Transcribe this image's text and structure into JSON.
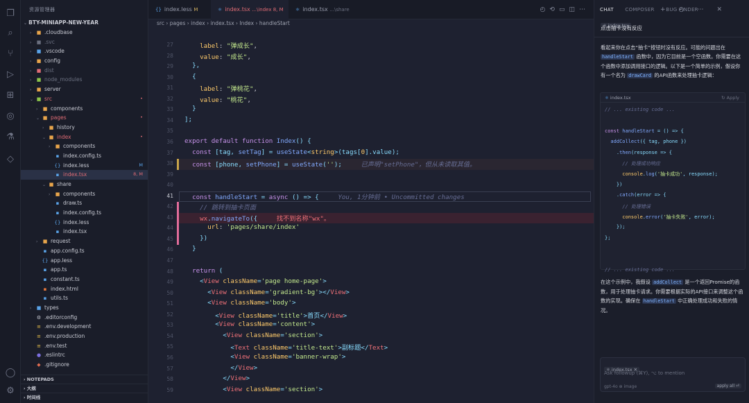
{
  "explorer": {
    "header": "资源管理器",
    "project": "BTY-MINIAPP-NEW-YEAR",
    "items": [
      {
        "name": ".cloudbase",
        "depth": 1,
        "kind": "folder",
        "open": false,
        "color": "#e8a54b"
      },
      {
        "name": ".svc",
        "depth": 1,
        "kind": "folder",
        "open": false,
        "color": "#6b7080",
        "dim": true
      },
      {
        "name": ".vscode",
        "depth": 1,
        "kind": "folder",
        "open": false,
        "color": "#5aa3e8"
      },
      {
        "name": "config",
        "depth": 1,
        "kind": "folder",
        "open": false,
        "color": "#e8a54b"
      },
      {
        "name": "dist",
        "depth": 1,
        "kind": "folder",
        "open": false,
        "color": "#e06c75",
        "dim": true
      },
      {
        "name": "node_modules",
        "depth": 1,
        "kind": "folder",
        "open": false,
        "color": "#8bc34a",
        "dim": true
      },
      {
        "name": "server",
        "depth": 1,
        "kind": "folder",
        "open": false,
        "color": "#e8a54b"
      },
      {
        "name": "src",
        "depth": 1,
        "kind": "folder",
        "open": true,
        "color": "#8bc34a",
        "text": "#e06c75",
        "dot": true
      },
      {
        "name": "components",
        "depth": 2,
        "kind": "folder",
        "open": false,
        "color": "#e8a54b"
      },
      {
        "name": "pages",
        "depth": 2,
        "kind": "folder",
        "open": true,
        "color": "#e8a54b",
        "text": "#e06c75",
        "dot": true
      },
      {
        "name": "history",
        "depth": 3,
        "kind": "folder",
        "open": false,
        "color": "#e8a54b"
      },
      {
        "name": "index",
        "depth": 3,
        "kind": "folder",
        "open": true,
        "color": "#e8a54b",
        "text": "#e06c75",
        "dot": true
      },
      {
        "name": "components",
        "depth": 4,
        "kind": "folder",
        "open": false,
        "color": "#e8a54b"
      },
      {
        "name": "index.config.ts",
        "depth": 4,
        "kind": "file",
        "color": "#5aa3e8"
      },
      {
        "name": "index.less",
        "depth": 4,
        "kind": "file",
        "color": "#5aa3e8",
        "text": "#c9cbd4",
        "badge": "M",
        "badgeColor": "#5aa3e8",
        "glyph": "{}"
      },
      {
        "name": "index.tsx",
        "depth": 4,
        "kind": "file",
        "color": "#5aa3e8",
        "text": "#e06c75",
        "badge": "8, M",
        "badgeColor": "#e06c75",
        "selected": true
      },
      {
        "name": "share",
        "depth": 3,
        "kind": "folder",
        "open": true,
        "color": "#e8a54b"
      },
      {
        "name": "components",
        "depth": 4,
        "kind": "folder",
        "open": false,
        "color": "#e8a54b"
      },
      {
        "name": "draw.ts",
        "depth": 4,
        "kind": "file",
        "color": "#5aa3e8"
      },
      {
        "name": "index.config.ts",
        "depth": 4,
        "kind": "file",
        "color": "#5aa3e8"
      },
      {
        "name": "index.less",
        "depth": 4,
        "kind": "file",
        "color": "#5aa3e8",
        "glyph": "{}"
      },
      {
        "name": "index.tsx",
        "depth": 4,
        "kind": "file",
        "color": "#5aa3e8"
      },
      {
        "name": "request",
        "depth": 2,
        "kind": "folder",
        "open": false,
        "color": "#e8a54b"
      },
      {
        "name": "app.config.ts",
        "depth": 2,
        "kind": "file",
        "color": "#5aa3e8"
      },
      {
        "name": "app.less",
        "depth": 2,
        "kind": "file",
        "color": "#5aa3e8",
        "glyph": "{}"
      },
      {
        "name": "app.ts",
        "depth": 2,
        "kind": "file",
        "color": "#5aa3e8"
      },
      {
        "name": "constant.ts",
        "depth": 2,
        "kind": "file",
        "color": "#5aa3e8"
      },
      {
        "name": "index.html",
        "depth": 2,
        "kind": "file",
        "color": "#e8783b"
      },
      {
        "name": "utils.ts",
        "depth": 2,
        "kind": "file",
        "color": "#5aa3e8"
      },
      {
        "name": "types",
        "depth": 1,
        "kind": "folder",
        "open": false,
        "color": "#5aa3e8"
      },
      {
        "name": ".editorconfig",
        "depth": 1,
        "kind": "file",
        "color": "#c9cbd4",
        "glyph": "⚙"
      },
      {
        "name": ".env.development",
        "depth": 1,
        "kind": "file",
        "color": "#e8c04b",
        "glyph": "≡"
      },
      {
        "name": ".env.production",
        "depth": 1,
        "kind": "file",
        "color": "#e8c04b",
        "glyph": "≡"
      },
      {
        "name": ".env.test",
        "depth": 1,
        "kind": "file",
        "color": "#e8c04b",
        "glyph": "≡"
      },
      {
        "name": ".eslintrc",
        "depth": 1,
        "kind": "file",
        "color": "#7c6fe0",
        "glyph": "●"
      },
      {
        "name": ".gitignore",
        "depth": 1,
        "kind": "file",
        "color": "#e06c50",
        "glyph": "◆"
      }
    ],
    "sections": [
      "NOTEPADS",
      "大纲",
      "时间线"
    ]
  },
  "tabs": [
    {
      "label": "index.less",
      "suffix": "M",
      "suffixColor": "#d0b060"
    },
    {
      "label": "index.tsx",
      "suffix": "...\\index 8, M",
      "suffixColor": "#e06c75",
      "active": true
    },
    {
      "label": "index.tsx",
      "suffix": "...\\share",
      "suffixColor": "#6b7080"
    }
  ],
  "breadcrumb": [
    "src",
    "pages",
    "index",
    "index.tsx",
    "Index",
    "handleStart"
  ],
  "code": {
    "lines": [
      {
        "n": "27",
        "t": [
          [
            "    ",
            ""
          ],
          [
            "label",
            "pr"
          ],
          [
            ": ",
            ""
          ],
          [
            "\"弹成长\"",
            "str"
          ],
          [
            ",",
            ""
          ]
        ]
      },
      {
        "n": "28",
        "t": [
          [
            "    ",
            ""
          ],
          [
            "value",
            "pr"
          ],
          [
            ": ",
            ""
          ],
          [
            "\"成长\"",
            "str"
          ],
          [
            ",",
            ""
          ]
        ]
      },
      {
        "n": "29",
        "t": [
          [
            "  },",
            "pu"
          ]
        ]
      },
      {
        "n": "30",
        "t": [
          [
            "  {",
            "pu"
          ]
        ]
      },
      {
        "n": "31",
        "t": [
          [
            "    ",
            ""
          ],
          [
            "label",
            "pr"
          ],
          [
            ": ",
            ""
          ],
          [
            "\"弹桃花\"",
            "str"
          ],
          [
            ",",
            ""
          ]
        ]
      },
      {
        "n": "32",
        "t": [
          [
            "    ",
            ""
          ],
          [
            "value",
            "pr"
          ],
          [
            ": ",
            ""
          ],
          [
            "\"桃花\"",
            "str"
          ],
          [
            ",",
            ""
          ]
        ]
      },
      {
        "n": "33",
        "t": [
          [
            "  }",
            "pu"
          ]
        ]
      },
      {
        "n": "34",
        "t": [
          [
            "];",
            "pu"
          ]
        ]
      },
      {
        "n": "35",
        "t": []
      },
      {
        "n": "36",
        "t": [
          [
            "export ",
            "kw"
          ],
          [
            "default ",
            "kw"
          ],
          [
            "function ",
            "kw"
          ],
          [
            "Index",
            "fn"
          ],
          [
            "() {",
            "pu"
          ]
        ]
      },
      {
        "n": "37",
        "t": [
          [
            "  const ",
            "kw"
          ],
          [
            "[tag, ",
            "pu"
          ],
          [
            "setTag",
            "fn"
          ],
          [
            "] = ",
            "pu"
          ],
          [
            "useState",
            "fn"
          ],
          [
            "<",
            "pu"
          ],
          [
            "string",
            "at"
          ],
          [
            ">(tags[",
            "pu"
          ],
          [
            "0",
            "pr"
          ],
          [
            "].value);",
            "pu"
          ]
        ]
      },
      {
        "n": "38",
        "t": [
          [
            "  const ",
            "kw"
          ],
          [
            "[phone, ",
            "pu"
          ],
          [
            "setPhone",
            "fn"
          ],
          [
            "] = ",
            "pu"
          ],
          [
            "useState",
            "fn"
          ],
          [
            "(",
            "pu"
          ],
          [
            "''",
            "str"
          ],
          [
            ");",
            "pu"
          ],
          [
            "     已声明\"setPhone\"，但从未读取其值。",
            "cm"
          ]
        ],
        "hl": "#2a2631",
        "bar": "#c7a44a"
      },
      {
        "n": "39",
        "t": []
      },
      {
        "n": "40",
        "t": []
      },
      {
        "n": "41",
        "t": [
          [
            "  const ",
            "kw"
          ],
          [
            "handleStart",
            "fn"
          ],
          [
            " = ",
            "pu"
          ],
          [
            "async ",
            "kw"
          ],
          [
            "() => {",
            "pu"
          ],
          [
            "     You, 1分钟前 • Uncommitted changes",
            "cm"
          ]
        ],
        "cur": true,
        "box": true
      },
      {
        "n": "42",
        "t": [
          [
            "    // 跳转到抽卡页面",
            "cm"
          ]
        ],
        "bar": "#e06c9a"
      },
      {
        "n": "43",
        "t": [
          [
            "    ",
            ""
          ],
          [
            "wx",
            "tg"
          ],
          [
            ".",
            "pu"
          ],
          [
            "navigateTo",
            "fn"
          ],
          [
            "({",
            "pu"
          ],
          [
            "     找不到名称\"wx\"。",
            "tg"
          ]
        ],
        "hl": "#3a2230",
        "bar": "#e06c9a"
      },
      {
        "n": "44",
        "t": [
          [
            "      ",
            ""
          ],
          [
            "url",
            "pr"
          ],
          [
            ": ",
            ""
          ],
          [
            "'pages/share/index'",
            "str"
          ]
        ],
        "bar": "#e06c9a"
      },
      {
        "n": "45",
        "t": [
          [
            "    })",
            "pu"
          ]
        ],
        "bar": "#e06c9a"
      },
      {
        "n": "46",
        "t": [
          [
            "  }",
            "pu"
          ]
        ]
      },
      {
        "n": "47",
        "t": []
      },
      {
        "n": "48",
        "t": [
          [
            "  return ",
            "kw"
          ],
          [
            "(",
            "pu"
          ]
        ]
      },
      {
        "n": "49",
        "t": [
          [
            "    <",
            "pu"
          ],
          [
            "View ",
            "tg"
          ],
          [
            "className",
            "at"
          ],
          [
            "=",
            "pu"
          ],
          [
            "'page home-page'",
            "str"
          ],
          [
            ">",
            "pu"
          ]
        ]
      },
      {
        "n": "50",
        "t": [
          [
            "      <",
            "pu"
          ],
          [
            "View ",
            "tg"
          ],
          [
            "className",
            "at"
          ],
          [
            "=",
            "pu"
          ],
          [
            "'gradient-bg'",
            "str"
          ],
          [
            "></",
            "pu"
          ],
          [
            "View",
            "tg"
          ],
          [
            ">",
            "pu"
          ]
        ]
      },
      {
        "n": "51",
        "t": [
          [
            "      <",
            "pu"
          ],
          [
            "View ",
            "tg"
          ],
          [
            "className",
            "at"
          ],
          [
            "=",
            "pu"
          ],
          [
            "'body'",
            "str"
          ],
          [
            ">",
            "pu"
          ]
        ]
      },
      {
        "n": "52",
        "t": [
          [
            "        <",
            "pu"
          ],
          [
            "View ",
            "tg"
          ],
          [
            "className",
            "at"
          ],
          [
            "=",
            "pu"
          ],
          [
            "'title'",
            "str"
          ],
          [
            ">首页</",
            "pu"
          ],
          [
            "View",
            "tg"
          ],
          [
            ">",
            "pu"
          ]
        ]
      },
      {
        "n": "53",
        "t": [
          [
            "        <",
            "pu"
          ],
          [
            "View ",
            "tg"
          ],
          [
            "className",
            "at"
          ],
          [
            "=",
            "pu"
          ],
          [
            "'content'",
            "str"
          ],
          [
            ">",
            "pu"
          ]
        ]
      },
      {
        "n": "54",
        "t": [
          [
            "          <",
            "pu"
          ],
          [
            "View ",
            "tg"
          ],
          [
            "className",
            "at"
          ],
          [
            "=",
            "pu"
          ],
          [
            "'section'",
            "str"
          ],
          [
            ">",
            "pu"
          ]
        ]
      },
      {
        "n": "55",
        "t": [
          [
            "            <",
            "pu"
          ],
          [
            "Text ",
            "tg"
          ],
          [
            "className",
            "at"
          ],
          [
            "=",
            "pu"
          ],
          [
            "'title-text'",
            "str"
          ],
          [
            ">副标题</",
            "pu"
          ],
          [
            "Text",
            "tg"
          ],
          [
            ">",
            "pu"
          ]
        ]
      },
      {
        "n": "56",
        "t": [
          [
            "            <",
            "pu"
          ],
          [
            "View ",
            "tg"
          ],
          [
            "className",
            "at"
          ],
          [
            "=",
            "pu"
          ],
          [
            "'banner-wrap'",
            "str"
          ],
          [
            ">",
            "pu"
          ]
        ]
      },
      {
        "n": "57",
        "t": [
          [
            "            </",
            "pu"
          ],
          [
            "View",
            "tg"
          ],
          [
            ">",
            "pu"
          ]
        ]
      },
      {
        "n": "58",
        "t": [
          [
            "          </",
            "pu"
          ],
          [
            "View",
            "tg"
          ],
          [
            ">",
            "pu"
          ]
        ]
      },
      {
        "n": "59",
        "t": [
          [
            "          <",
            "pu"
          ],
          [
            "View ",
            "tg"
          ],
          [
            "className",
            "at"
          ],
          [
            "=",
            "pu"
          ],
          [
            "'section'",
            "str"
          ],
          [
            ">",
            "pu"
          ]
        ]
      }
    ]
  },
  "chat": {
    "tabs": [
      "CHAT",
      "COMPOSER",
      "BUG FINDER"
    ],
    "topchip": "index.tsx",
    "user_msg": "点击抽卡没有反应",
    "reply1a": "看起来你在点击“抽卡”按钮时没有反应。可能的问题出在 ",
    "reply1code": "handleStart",
    "reply1b": " 函数中，因为它目前是一个空函数。你需要在这个函数中添加调用接口的逻辑。以下是一个简单的示例，假设你有一个名为 ",
    "reply1code2": "drawCard",
    "reply1c": " 的API函数来处理抽卡逻辑：",
    "block_file": "index.tsx",
    "block_apply": "Apply",
    "block_lines": [
      [
        [
          "// ... existing code ...",
          "cm"
        ]
      ],
      [],
      [
        [
          "const ",
          "kw"
        ],
        [
          "handleStart",
          "fn"
        ],
        [
          " = () => {",
          "pu"
        ]
      ],
      [
        [
          "  addCollect",
          "fn"
        ],
        [
          "({ tag, phone })",
          "pu"
        ]
      ],
      [
        [
          "    .",
          "pu"
        ],
        [
          "then",
          "fn"
        ],
        [
          "(response => {",
          "pu"
        ]
      ],
      [
        [
          "      // 处理成功响应",
          "cm"
        ]
      ],
      [
        [
          "      console",
          "pr"
        ],
        [
          ".",
          "pu"
        ],
        [
          "log",
          "fn"
        ],
        [
          "(",
          "pu"
        ],
        [
          "'抽卡成功'",
          "str"
        ],
        [
          ", response);",
          "pu"
        ]
      ],
      [
        [
          "    })",
          "pu"
        ]
      ],
      [
        [
          "    .",
          "pu"
        ],
        [
          "catch",
          "fn"
        ],
        [
          "(error => {",
          "pu"
        ]
      ],
      [
        [
          "      // 处理错误",
          "cm"
        ]
      ],
      [
        [
          "      console",
          "pr"
        ],
        [
          ".",
          "pu"
        ],
        [
          "error",
          "fn"
        ],
        [
          "(",
          "pu"
        ],
        [
          "'抽卡失败'",
          "str"
        ],
        [
          ", error);",
          "pu"
        ]
      ],
      [
        [
          "    });",
          "pu"
        ]
      ],
      [
        [
          "};",
          "pu"
        ]
      ],
      [],
      [],
      [
        [
          "// ... existing code ...",
          "cm"
        ]
      ]
    ],
    "reply2a": "在这个示例中，我假设 ",
    "reply2code": "addCollect",
    "reply2b": " 是一个返回Promise的函数，用于处理抽卡请求。你需要根据实际的API接口来调整这个函数的实现。确保在 ",
    "reply2code2": "handleStart",
    "reply2c": " 中正确处理成功和失败的情况。",
    "input_chip": "index.tsx",
    "input_placeholder": "Ask followup (⌘Y), ⌥ to mention",
    "model": "gpt-4o",
    "mode_hint": "⊕ image",
    "submit": "apply all ⏎"
  }
}
